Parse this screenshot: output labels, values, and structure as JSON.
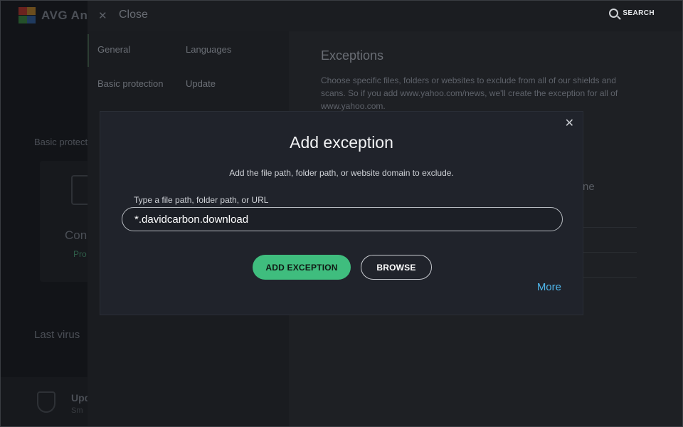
{
  "app": {
    "brand": "AVG",
    "brand_suffix": "An",
    "basic_protection_fragment": "Basic protect",
    "computer_fragment": "Con",
    "protected_fragment": "Pro",
    "last_virus_fragment": "Last virus",
    "update_fragment": "Upd",
    "sub_fragment": "Sm",
    "logo_colors": [
      "#e0362c",
      "#f5a623",
      "#3ba935",
      "#2d6dbf"
    ]
  },
  "settings": {
    "close_label": "Close",
    "search_label": "SEARCH",
    "nav": [
      {
        "label": "General"
      },
      {
        "label": "Languages"
      },
      {
        "label": "Basic protection"
      },
      {
        "label": "Update"
      }
    ],
    "content": {
      "title": "Exceptions",
      "description": "Choose specific files, folders or websites to exclude from all of our shields and scans. So if you add www.yahoo.com/news, we'll create the exception for all of www.yahoo.com.",
      "fragment": "ne"
    }
  },
  "dialog": {
    "title": "Add exception",
    "subtitle": "Add the file path, folder path, or website domain to exclude.",
    "field_label": "Type a file path, folder path, or URL",
    "field_value": "*.davidcarbon.download",
    "add_button": "ADD EXCEPTION",
    "browse_button": "BROWSE",
    "more_link": "More"
  },
  "colors": {
    "accent_green": "#3fbd7e",
    "link_blue": "#4fb7ec"
  }
}
